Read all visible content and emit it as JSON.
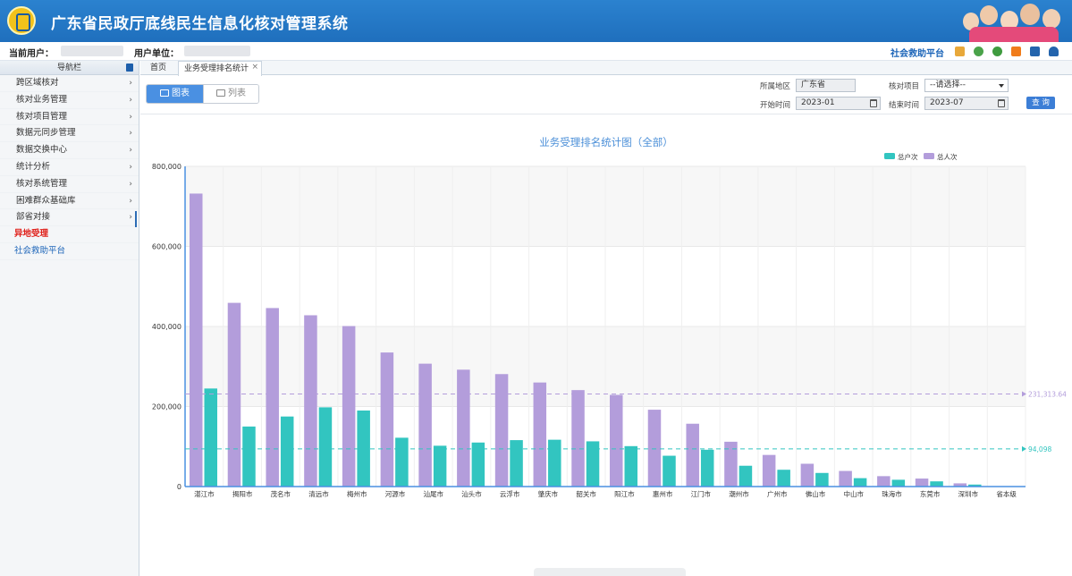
{
  "header": {
    "title": "广东省民政厅底线民生信息化核对管理系统"
  },
  "subbar": {
    "current_user_label": "当前用户：",
    "user_unit_label": "用户单位：",
    "platform_link": "社会救助平台"
  },
  "sidebar": {
    "title": "导航栏",
    "items": [
      {
        "label": "跨区域核对",
        "chevron": "›"
      },
      {
        "label": "核对业务管理",
        "chevron": "›"
      },
      {
        "label": "核对项目管理",
        "chevron": "›"
      },
      {
        "label": "数据元同步管理",
        "chevron": "›"
      },
      {
        "label": "数据交换中心",
        "chevron": "›"
      },
      {
        "label": "统计分析",
        "chevron": "›"
      },
      {
        "label": "核对系统管理",
        "chevron": "›"
      },
      {
        "label": "困难群众基础库",
        "chevron": "›"
      },
      {
        "label": "部省对接",
        "chevron": "›"
      },
      {
        "label": "异地受理",
        "chevron": ""
      },
      {
        "label": "社会救助平台",
        "chevron": ""
      }
    ]
  },
  "tabs": {
    "home": "首页",
    "active": "业务受理排名统计",
    "close": "×"
  },
  "toolbar": {
    "chart_btn": "图表",
    "list_btn": "列表",
    "region_label": "所属地区",
    "region_value": "广东省",
    "project_label": "核对项目",
    "project_value": "--请选择--",
    "start_label": "开始时间",
    "start_value": "2023-01",
    "end_label": "结束时间",
    "end_value": "2023-07",
    "query_btn": "查 询"
  },
  "colors": {
    "households": "#32c5c0",
    "persons": "#b39ddb",
    "header": "#2177c6"
  },
  "chart_data": {
    "type": "bar",
    "title": "业务受理排名统计图（全部）",
    "categories": [
      "湛江市",
      "揭阳市",
      "茂名市",
      "清远市",
      "梅州市",
      "河源市",
      "汕尾市",
      "汕头市",
      "云浮市",
      "肇庆市",
      "韶关市",
      "阳江市",
      "惠州市",
      "江门市",
      "潮州市",
      "广州市",
      "佛山市",
      "中山市",
      "珠海市",
      "东莞市",
      "深圳市",
      "省本级"
    ],
    "series": [
      {
        "name": "总户次",
        "values": [
          245000,
          150000,
          175000,
          198000,
          190000,
          122000,
          102000,
          110000,
          116000,
          117000,
          113000,
          101000,
          77000,
          92000,
          52000,
          42000,
          34000,
          21000,
          17000,
          13000,
          5000,
          500
        ]
      },
      {
        "name": "总人次",
        "values": [
          732000,
          459000,
          446000,
          428000,
          401000,
          335000,
          307000,
          292000,
          281000,
          260000,
          241000,
          229000,
          192000,
          157000,
          112000,
          79000,
          57000,
          39000,
          26000,
          20000,
          8000,
          1000
        ]
      }
    ],
    "ylim": [
      0,
      800000
    ],
    "yticks": [
      "0",
      "200,000",
      "400,000",
      "600,000",
      "800,000"
    ],
    "avg_lines": [
      {
        "series": "总户次",
        "value": 94098,
        "label": "94,098"
      },
      {
        "series": "总人次",
        "value": 231313.64,
        "label": "231,313.64"
      }
    ],
    "legend_position": "top-right",
    "grid": true
  }
}
